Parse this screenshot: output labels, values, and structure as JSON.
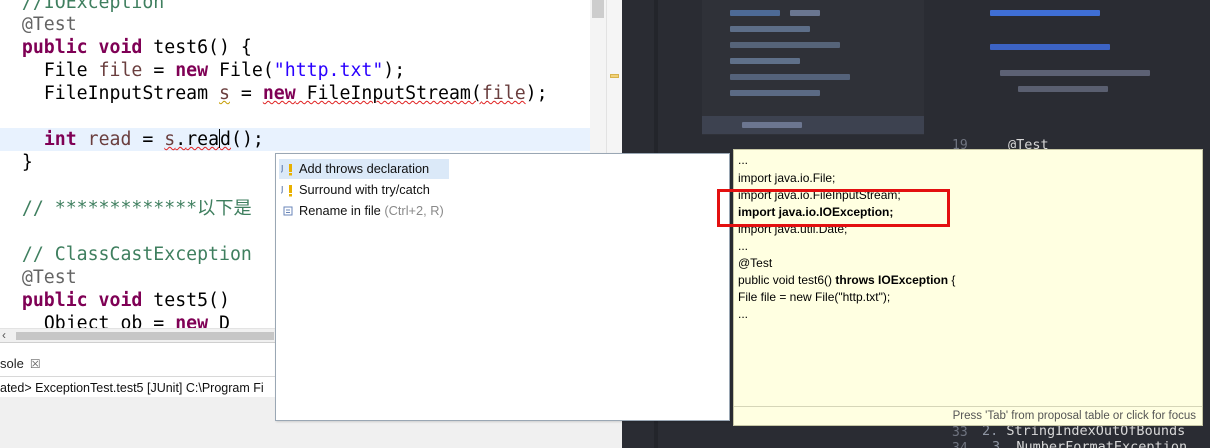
{
  "editor": {
    "lines": {
      "l0": "//IOException",
      "l1": "@Test",
      "l2_kw": "public void",
      "l2_rest": " test6() {",
      "l3_type": "File ",
      "l3_var": "file",
      "l3_mid": " = ",
      "l3_kw": "new",
      "l3_call": " File(",
      "l3_str": "\"http.txt\"",
      "l3_end": ");",
      "l4_type": "FileInputStream ",
      "l4_var": "s",
      "l4_mid": " = ",
      "l4_kw": "new",
      "l4_call": " FileInputStream(",
      "l4_arg": "file",
      "l4_end": ");",
      "l6_kw": "int",
      "l6_var": " read",
      "l6_mid": " = ",
      "l6_obj": "s",
      "l6_dot": ".",
      "l6_m1": "rea",
      "l6_m2": "d",
      "l6_end": "();",
      "l7": "}",
      "l9_comment": "// *************以下是",
      "l11_comment": "// ClassCastException",
      "l12": "@Test",
      "l13_kw": "public void",
      "l13_rest": " test5()",
      "l14_text": "Object ob = ",
      "l14_kw": "new",
      "l14_rest": " D"
    }
  },
  "console": {
    "tab_label": "sole",
    "close_glyph": "☒",
    "description": "ated> ExceptionTest.test5 [JUnit] C:\\Program Fi"
  },
  "proposals": {
    "items": [
      {
        "label": "Add throws declaration",
        "shortcut": "",
        "icon": "java-quickfix-icon"
      },
      {
        "label": "Surround with try/catch",
        "shortcut": "",
        "icon": "java-quickfix-icon"
      },
      {
        "label": "Rename in file",
        "shortcut": " (Ctrl+2, R)",
        "icon": "rename-icon"
      }
    ]
  },
  "info": {
    "lines": {
      "i0": "...",
      "i1": "import java.io.File;",
      "i2": "import java.io.FileInputStream;",
      "i3": "import java.io.IOException;",
      "i4": "import java.util.Date;",
      "i5": "...",
      "i6": "@Test",
      "i7a": "public void test6() ",
      "i7b": "throws IOException",
      "i7c": " {",
      "i8": "File file = new File(\"http.txt\");",
      "i9": "..."
    },
    "footer": "Press 'Tab' from proposal table or click for focus"
  },
  "dark_editor": {
    "annotation": "@Test",
    "line_numbers": [
      "19",
      "33",
      "34"
    ],
    "line_33_num": "2.",
    "line_33_text": " StringIndexOutOfBounds",
    "line_34_num": "3.",
    "line_34_text": " NumberFormatException"
  },
  "colors": {
    "keyword": "#7f0055",
    "string": "#2a00ff",
    "comment": "#3f7f5f",
    "annotation": "#646464",
    "highlight_box": "#e31010",
    "info_background": "#ffffe1"
  }
}
